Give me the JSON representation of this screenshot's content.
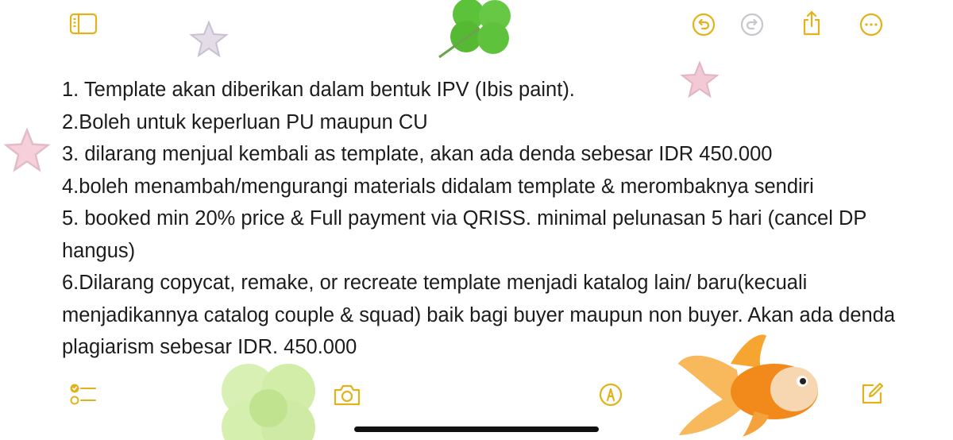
{
  "colors": {
    "accent": "#e3b21b",
    "accent_disabled": "#c7c7cc",
    "text": "#1c1c1e"
  },
  "toolbar_top": {
    "icons": [
      "sidebar-icon",
      "undo-icon",
      "redo-icon",
      "share-icon",
      "more-icon"
    ]
  },
  "toolbar_bottom": {
    "icons": [
      "checklist-icon",
      "camera-icon",
      "markup-icon",
      "compose-icon"
    ]
  },
  "note": {
    "lines": [
      "1. Template akan diberikan dalam bentuk IPV (Ibis paint).",
      "2.Boleh untuk keperluan PU maupun CU",
      "3. dilarang menjual kembali as template, akan ada denda sebesar IDR 450.000",
      "4.boleh menambah/mengurangi materials didalam template & merombaknya sendiri",
      "5. booked min 20% price & Full payment via QRISS. minimal pelunasan 5 hari (cancel DP hangus)",
      "6.Dilarang copycat, remake, or recreate template menjadi katalog lain/ baru(kecuali menjadikannya catalog couple & squad) baik bagi buyer maupun non buyer. Akan ada denda plagiarism sebesar IDR. 450.000"
    ]
  },
  "stickers": [
    "star-sticker",
    "clover-sticker",
    "goldfish-sticker"
  ]
}
